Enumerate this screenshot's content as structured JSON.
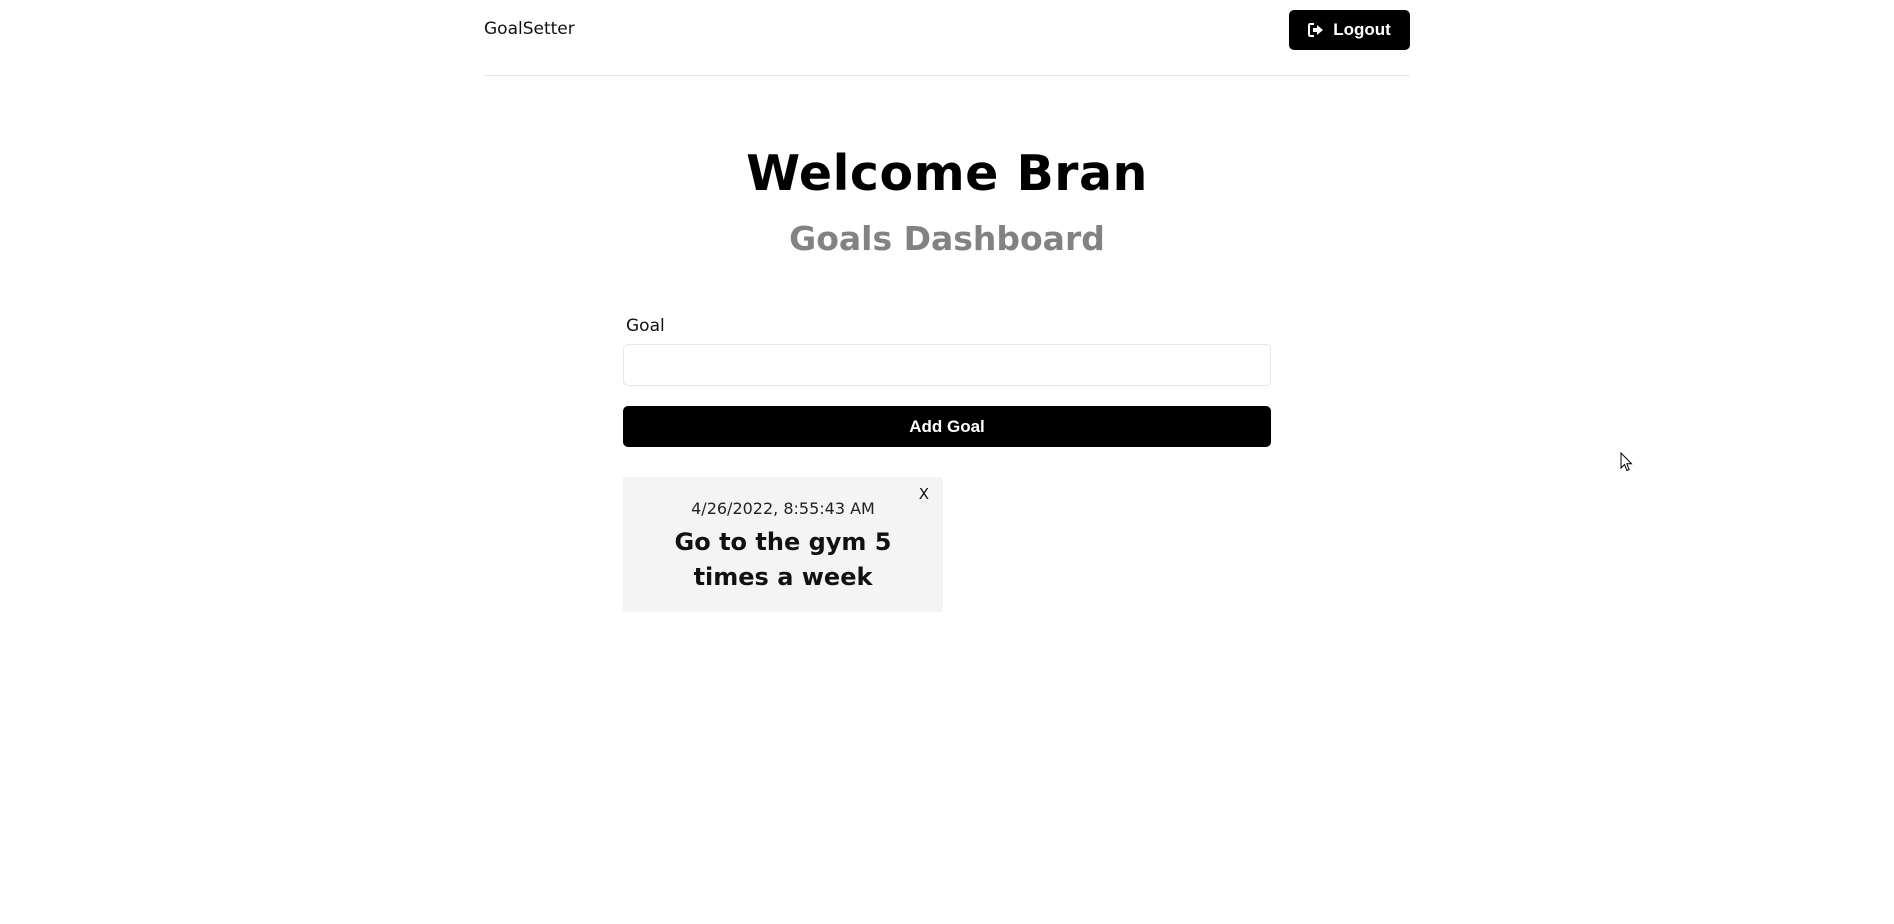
{
  "header": {
    "logo": "GoalSetter",
    "logout_label": "Logout",
    "logout_icon": "sign-out-icon"
  },
  "heading": {
    "welcome": "Welcome Bran",
    "subtitle": "Goals Dashboard"
  },
  "form": {
    "goal_label": "Goal",
    "goal_value": "",
    "goal_placeholder": "",
    "add_button_label": "Add Goal"
  },
  "goals": [
    {
      "date": "4/26/2022, 8:55:43 AM",
      "text": "Go to the gym 5 times a week",
      "close_label": "X"
    }
  ],
  "colors": {
    "primary": "#000000",
    "subtitle": "#828282",
    "card_bg": "#f4f4f4",
    "divider": "#e6e6e6"
  }
}
